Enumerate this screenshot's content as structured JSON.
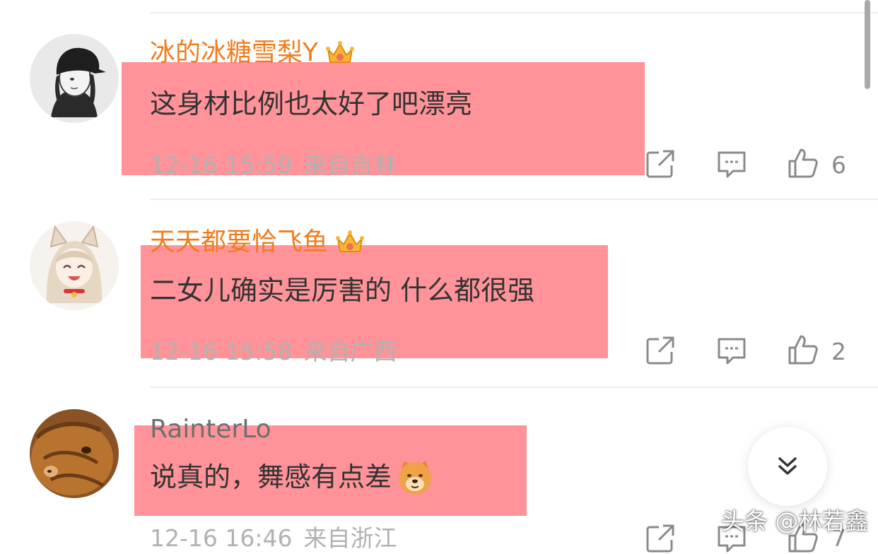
{
  "comments": [
    {
      "username": "冰的冰糖雪梨Y",
      "vip": true,
      "text": "这身材比例也太好了吧漂亮",
      "time": "12-16 15:59",
      "location": "来自吉林",
      "likes": "6",
      "avatar": "girl-black-cap-avatar"
    },
    {
      "username": "天天都要恰飞鱼",
      "vip": true,
      "text": "二女儿确实是厉害的 什么都很强",
      "time": "12-16 15:58",
      "location": "来自广西",
      "likes": "2",
      "avatar": "anime-fox-girl-avatar"
    },
    {
      "username": "RainterLo",
      "vip": false,
      "text": "说真的，舞感有点差",
      "emoji": "doge-emoji",
      "time": "12-16 16:46",
      "location": "来自浙江",
      "likes": "7",
      "avatar": "cat-photo-avatar"
    }
  ],
  "watermark": "头条 @林若鑫",
  "colors": {
    "username_vip": "#f07d1c",
    "username_normal": "#6f6f6f",
    "highlight": "#ff6068",
    "meta": "#b1b1b1",
    "comment_text": "#333333"
  },
  "icons": {
    "crown": "vip-crown-icon",
    "forward": "share-icon",
    "reply": "comment-icon",
    "like": "thumbs-up-icon",
    "scroll_down": "chevron-double-down-icon"
  }
}
